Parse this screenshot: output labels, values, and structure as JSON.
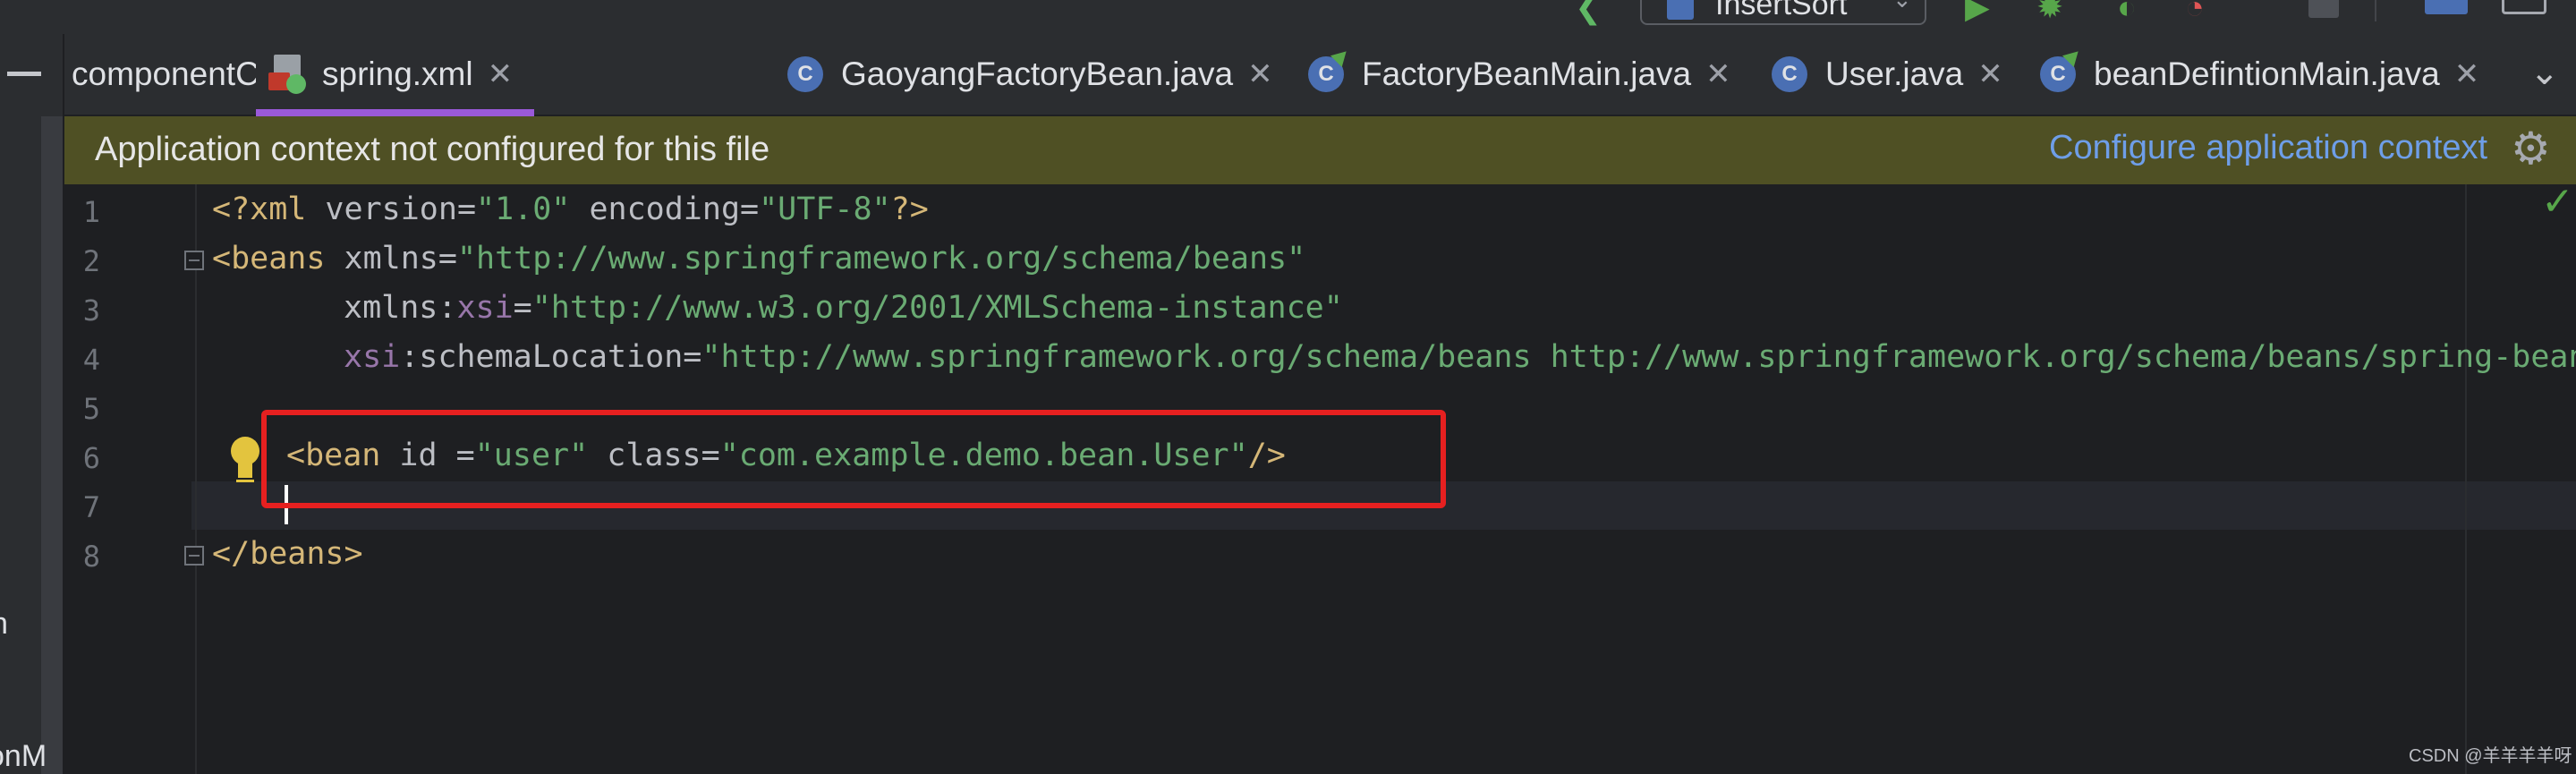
{
  "toolbar": {
    "run_config_label": "InsertSort"
  },
  "left_panel": {
    "cut_text_1": "n",
    "cut_text_2": "onM"
  },
  "tabs": [
    {
      "label": "componentConfig.java",
      "close": "✕"
    },
    {
      "label": "spring.xml",
      "close": "✕",
      "active": true
    },
    {
      "label": "GaoyangFactoryBean.java",
      "close": "✕",
      "icon_letter": "C"
    },
    {
      "label": "FactoryBeanMain.java",
      "close": "✕",
      "icon_letter": "C"
    },
    {
      "label": "User.java",
      "close": "✕",
      "icon_letter": "C"
    },
    {
      "label": "beanDefintionMain.java",
      "close": "✕",
      "icon_letter": "C"
    }
  ],
  "banner": {
    "message": "Application context not configured for this file",
    "action_link": "Configure application context"
  },
  "editor": {
    "line_numbers": [
      "1",
      "2",
      "3",
      "4",
      "5",
      "6",
      "7",
      "8"
    ],
    "line1": {
      "open": "<?xml",
      "attr1": " version",
      "eq1": "=",
      "val1": "\"1.0\"",
      "attr2": " encoding",
      "eq2": "=",
      "val2": "\"UTF-8\"",
      "close": "?>"
    },
    "line2": {
      "tag": "<beans",
      "attr": " xmlns",
      "eq": "=",
      "val": "\"http://www.springframework.org/schema/beans\""
    },
    "line3": {
      "attr": "xmlns:",
      "ns": "xsi",
      "eq": "=",
      "val": "\"http://www.w3.org/2001/XMLSchema-instance\""
    },
    "line4": {
      "ns": "xsi",
      "attr": ":schemaLocation",
      "eq": "=",
      "val": "\"http://www.springframework.org/schema/beans http://www.springframework.org/schema/beans/spring-bean"
    },
    "line6": {
      "tag": "<bean",
      "attr1": " id ",
      "eq1": "=",
      "val1": "\"user\"",
      "attr2": " class",
      "eq2": "=",
      "val2": "\"com.example.demo.bean.User\"",
      "close": "/>"
    },
    "line8": {
      "tag": "</beans>"
    }
  },
  "watermark": "CSDN @羊羊羊羊呀",
  "colors": {
    "tab_active_indicator": "#9a59d9",
    "highlight_box": "#e62020",
    "banner_bg": "#4f5024",
    "link": "#6e9ee8"
  }
}
